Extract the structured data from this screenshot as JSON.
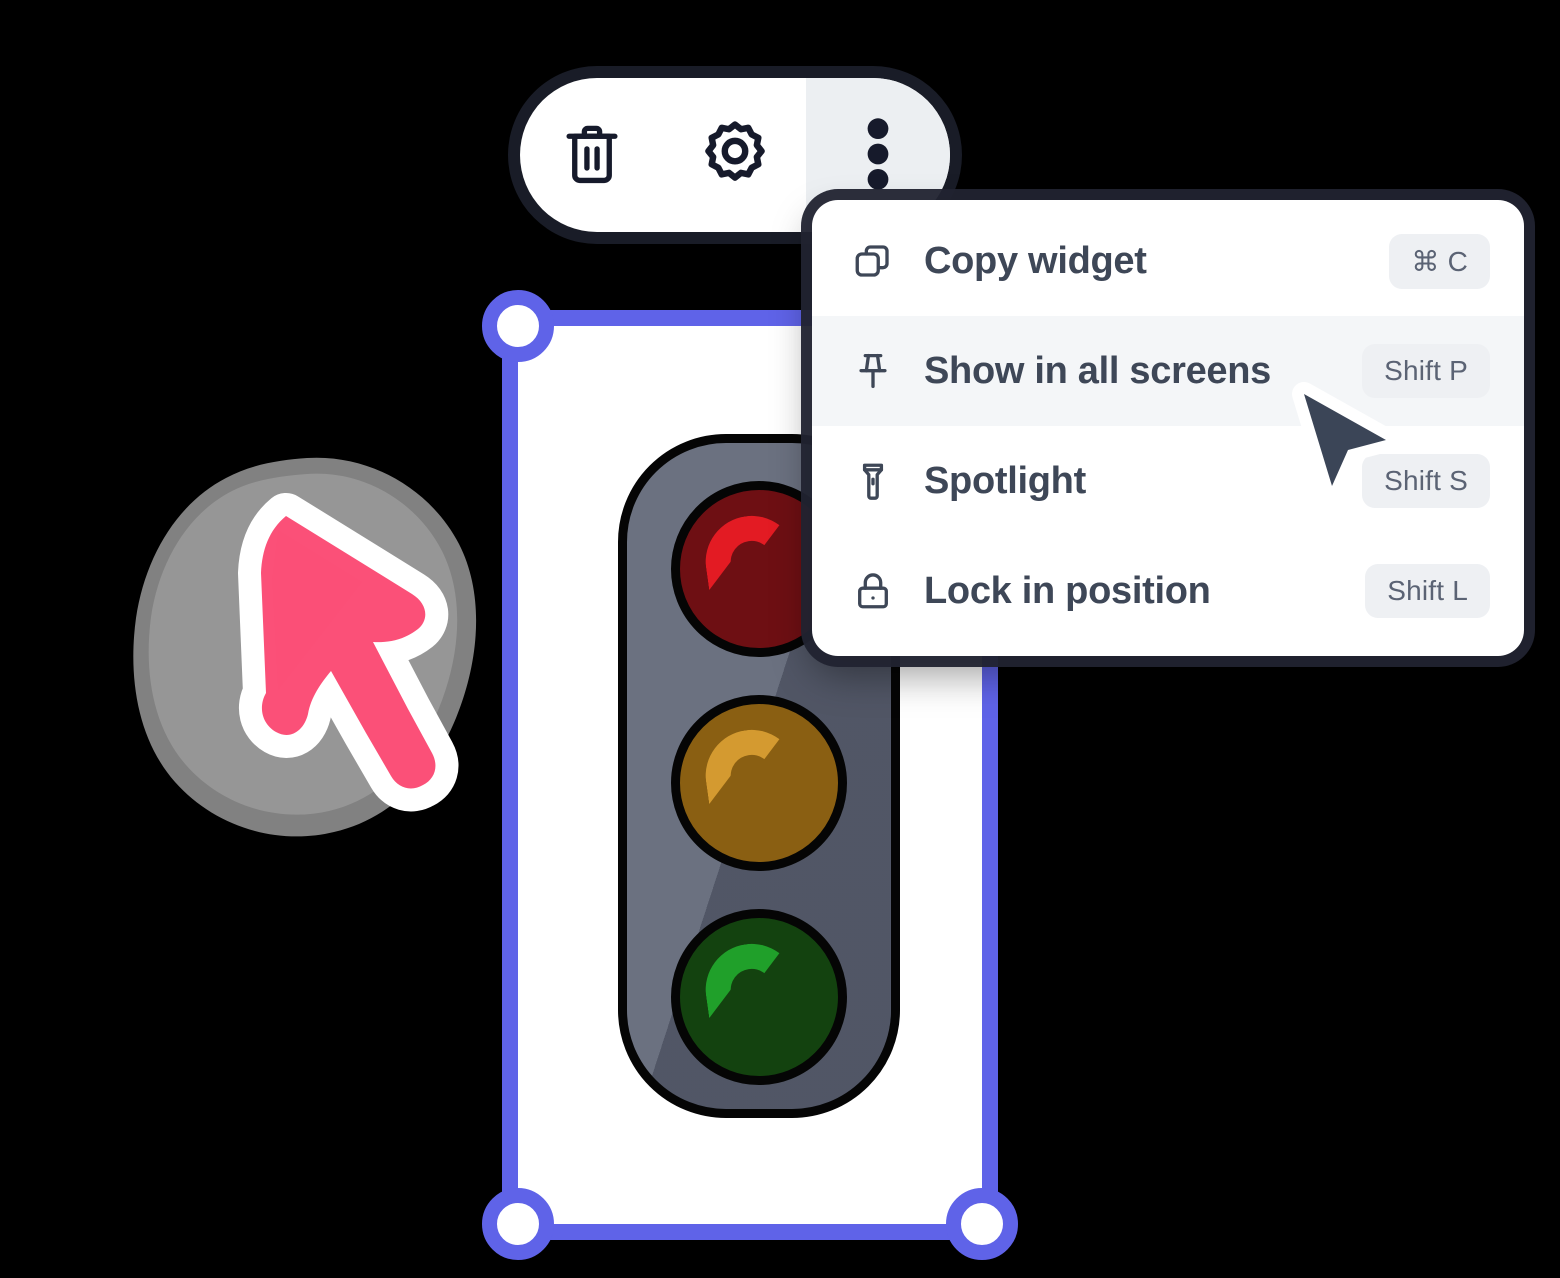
{
  "toolbar": {
    "buttons": [
      {
        "id": "delete",
        "icon": "trash-icon",
        "label": "Delete widget"
      },
      {
        "id": "settings",
        "icon": "gear-icon",
        "label": "Widget settings"
      },
      {
        "id": "more",
        "icon": "more-vertical-icon",
        "label": "More options",
        "active": true
      }
    ]
  },
  "context_menu": {
    "items": [
      {
        "icon": "copy-icon",
        "label": "Copy widget",
        "shortcut": "⌘ C",
        "highlighted": false
      },
      {
        "icon": "pin-icon",
        "label": "Show in all screens",
        "shortcut": "Shift P",
        "highlighted": true
      },
      {
        "icon": "flashlight-icon",
        "label": "Spotlight",
        "shortcut": "Shift S",
        "highlighted": false
      },
      {
        "icon": "lock-icon",
        "label": "Lock in position",
        "shortcut": "Shift L",
        "highlighted": false
      }
    ]
  },
  "widget": {
    "type": "traffic-light-widget",
    "lamps": [
      {
        "name": "red-lamp",
        "color": "#6e0f13",
        "highlight": "#e31b23"
      },
      {
        "name": "yellow-lamp",
        "color": "#8a5f12",
        "highlight": "#d49a30"
      },
      {
        "name": "green-lamp",
        "color": "#13420f",
        "highlight": "#20a02a"
      }
    ],
    "housing_color": "#6b7180",
    "selection_color": "#5f63e8",
    "handles": [
      "top-left",
      "bottom-left",
      "bottom-right"
    ]
  },
  "sticker": {
    "name": "pin-sticker",
    "pin_color": "#fb5078",
    "outline_color": "#ffffff",
    "blob_color": "#8c8c8c"
  },
  "cursor": {
    "name": "mouse-pointer",
    "fill": "#3b4557",
    "outline": "#ffffff"
  },
  "colors": {
    "accent_purple": "#5f63e8",
    "menu_text": "#3e4757",
    "shortcut_bg": "#eef0f3",
    "highlight_row": "#f4f6f8",
    "toolbar_active": "#eceff2",
    "icon_dark": "#161a2b"
  }
}
